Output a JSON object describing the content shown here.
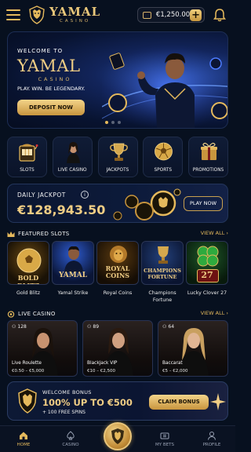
{
  "header": {
    "brand": "YAMAL",
    "brand_sub": "CASINO",
    "balance": "€1,250.00",
    "add_funds": "+"
  },
  "hero": {
    "welcome": "WELCOME TO",
    "title": "YAMAL",
    "subtitle": "CASINO",
    "tagline": "PLAY. WIN. BE LEGENDARY.",
    "cta": "DEPOSIT NOW",
    "slides": 3,
    "active_slide": 1
  },
  "categories": [
    {
      "label": "SLOTS",
      "icon": "slot-machine-icon"
    },
    {
      "label": "LIVE CASINO",
      "icon": "dealer-icon"
    },
    {
      "label": "JACKPOTS",
      "icon": "trophy-icon"
    },
    {
      "label": "SPORTS",
      "icon": "soccer-ball-icon"
    },
    {
      "label": "PROMOTIONS",
      "icon": "gift-icon"
    }
  ],
  "jackpot": {
    "label": "DAILY JACKPOT",
    "info": "i",
    "amount": "€128,943.50",
    "cta": "PLAY NOW"
  },
  "featured": {
    "title": "FEATURED SLOTS",
    "view_all": "VIEW ALL  ›",
    "games": [
      {
        "name": "Gold Blitz",
        "art": "BOLD BLITZ"
      },
      {
        "name": "Yamal Strike",
        "art": "YAMAL"
      },
      {
        "name": "Royal Coins",
        "art": "ROYAL COINS"
      },
      {
        "name": "Champions Fortune",
        "art": "CHAMPIONS FORTUNE"
      },
      {
        "name": "Lucky Clover 27",
        "art": "27"
      }
    ]
  },
  "live": {
    "title": "LIVE CASINO",
    "view_all": "VIEW ALL  ›",
    "tables": [
      {
        "players": "128",
        "name": "Live Roulette",
        "limits": "€0.50 – €5,000"
      },
      {
        "players": "89",
        "name": "Blackjack VIP",
        "limits": "€10 – €2,500"
      },
      {
        "players": "64",
        "name": "Baccarat",
        "limits": "€5 – €2,000"
      }
    ]
  },
  "bonus": {
    "label": "WELCOME BONUS",
    "title": "100% UP TO €500",
    "sub": "+ 100 FREE SPINS",
    "cta": "CLAIM BONUS"
  },
  "nav": {
    "home": "HOME",
    "casino": "CASINO",
    "bets": "MY BETS",
    "profile": "PROFILE"
  },
  "colors": {
    "accent_gold": "#e5b95c",
    "background": "#07101f"
  }
}
